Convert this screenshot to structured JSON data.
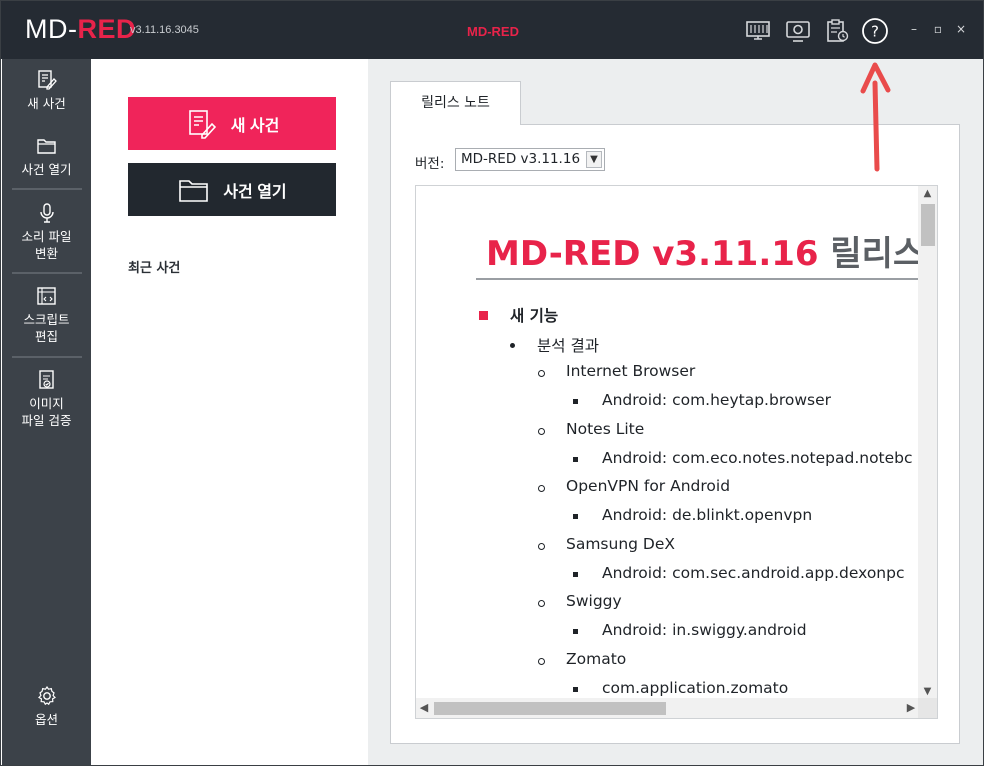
{
  "app": {
    "brand_prefix": "MD-",
    "brand_suffix": "RED",
    "version": "v3.11.16.3045",
    "window_title": "MD-RED"
  },
  "toolbar": {
    "icons": [
      "monitor-grid-icon",
      "camera-screen-icon",
      "clipboard-clock-icon",
      "help-icon"
    ]
  },
  "window_controls": {
    "minimize": "–",
    "maximize": "▫",
    "close": "×"
  },
  "sidebar": {
    "items": [
      {
        "label": "새 사건",
        "icon": "new-case-icon"
      },
      {
        "label": "사건 열기",
        "icon": "folder-icon"
      },
      {
        "label": "소리 파일\n변환",
        "line1": "소리 파일",
        "line2": "변환",
        "icon": "microphone-icon"
      },
      {
        "label": "스크립트 편집",
        "line1": "스크립트",
        "line2": "편집",
        "icon": "script-icon"
      },
      {
        "label": "이미지 파일 검증",
        "line1": "이미지",
        "line2": "파일 검증",
        "icon": "image-verify-icon"
      }
    ],
    "options_label": "옵션"
  },
  "actions": {
    "new_case": "새 사건",
    "open_case": "사건 열기",
    "recent_cases": "최근 사건"
  },
  "release_notes": {
    "tab_label": "릴리스 노트",
    "version_label": "버전:",
    "version_value": "MD-RED v3.11.16",
    "doc_title_red": "MD-RED v3.11.16",
    "doc_title_gray": "릴리스",
    "section": "새 기능",
    "subsection": "분석 결과",
    "entries": [
      {
        "name": "Internet Browser",
        "detail": "Android: com.heytap.browser"
      },
      {
        "name": "Notes Lite",
        "detail": "Android: com.eco.notes.notepad.notebc"
      },
      {
        "name": "OpenVPN for Android",
        "detail": "Android: de.blinkt.openvpn"
      },
      {
        "name": "Samsung DeX",
        "detail": "Android: com.sec.android.app.dexonpc"
      },
      {
        "name": "Swiggy",
        "detail": "Android: in.swiggy.android"
      },
      {
        "name": "Zomato",
        "detail": "com.application.zomato"
      }
    ]
  },
  "colors": {
    "accent": "#e8234a",
    "new_button": "#f0245a",
    "titlebar": "#252b33",
    "sidebar": "#3c4249",
    "annotation_arrow": "#e94b4b"
  }
}
